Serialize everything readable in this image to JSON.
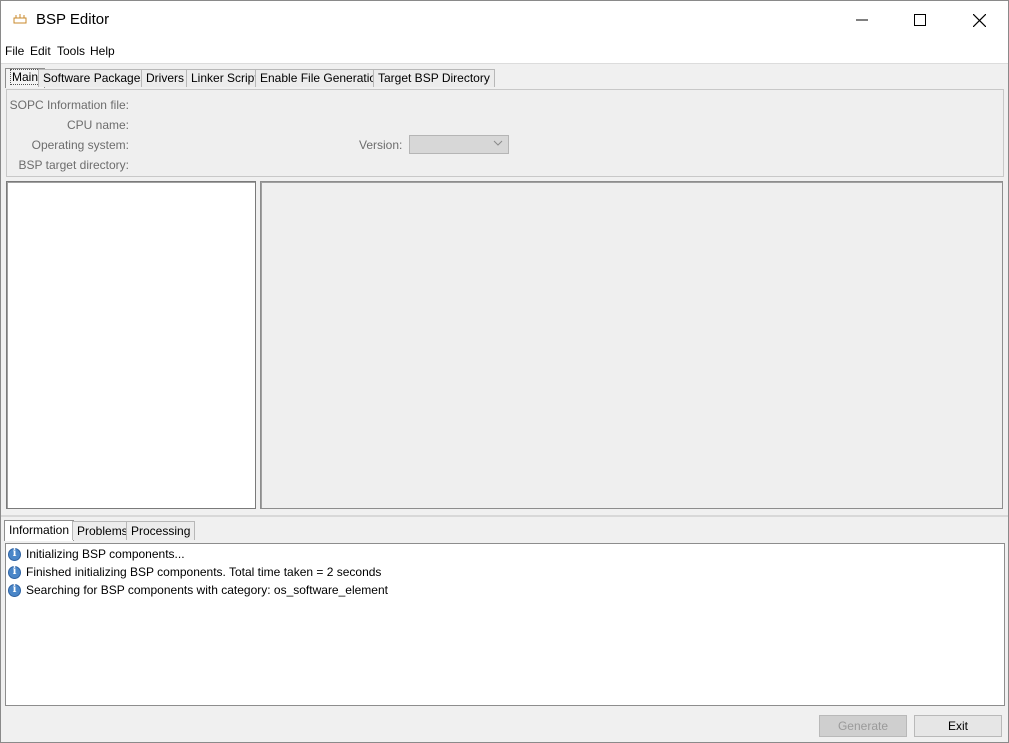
{
  "window": {
    "title": "BSP Editor",
    "controls": {
      "minimize": "minimize",
      "maximize": "maximize",
      "close": "close"
    }
  },
  "menu": [
    "File",
    "Edit",
    "Tools",
    "Help"
  ],
  "tabs": [
    {
      "label": "Main",
      "active": true
    },
    {
      "label": "Software Packages",
      "active": false
    },
    {
      "label": "Drivers",
      "active": false
    },
    {
      "label": "Linker Script",
      "active": false
    },
    {
      "label": "Enable File Generation",
      "active": false
    },
    {
      "label": "Target BSP Directory",
      "active": false
    }
  ],
  "main": {
    "sopc_label": "SOPC Information file:",
    "cpu_label": "CPU name:",
    "os_label": "Operating system:",
    "target_dir_label": "BSP target directory:",
    "version_label": "Version:",
    "version_value": ""
  },
  "bottom_tabs": [
    {
      "label": "Information",
      "active": true
    },
    {
      "label": "Problems",
      "active": false
    },
    {
      "label": "Processing",
      "active": false
    }
  ],
  "log": [
    {
      "icon": "info-icon",
      "text": "Initializing BSP components..."
    },
    {
      "icon": "info-icon",
      "text": "Finished initializing BSP components. Total time taken = 2 seconds"
    },
    {
      "icon": "info-icon",
      "text": "Searching for BSP components with category: os_software_element"
    }
  ],
  "buttons": {
    "generate": "Generate",
    "exit": "Exit"
  },
  "colors": {
    "titlebar": "#ffffff",
    "panel": "#f0f0f0",
    "info_icon": "#4a86c8",
    "disabled_text": "#6d6d6d"
  }
}
